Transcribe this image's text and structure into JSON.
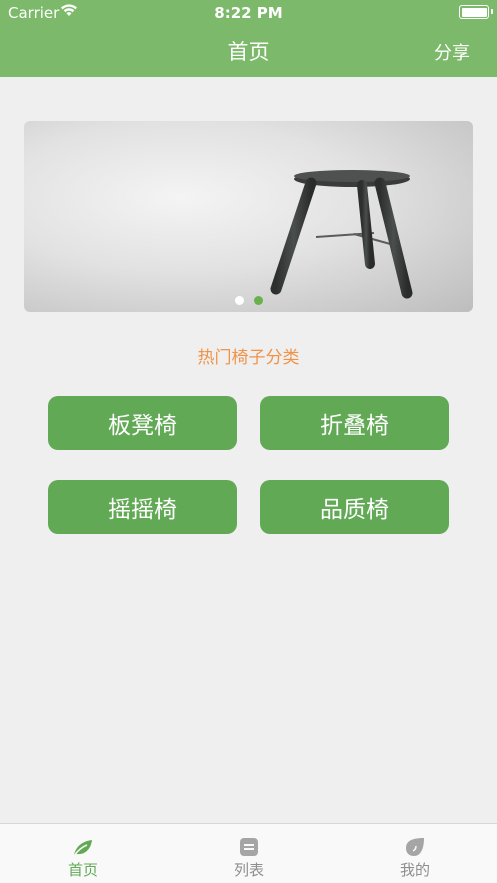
{
  "status_bar": {
    "carrier": "Carrier",
    "time": "8:22 PM"
  },
  "nav": {
    "title": "首页",
    "share_label": "分享"
  },
  "banner": {
    "page_count": 2,
    "active_page": 2
  },
  "section_title": "热门椅子分类",
  "categories": [
    {
      "label": "板凳椅"
    },
    {
      "label": "折叠椅"
    },
    {
      "label": "摇摇椅"
    },
    {
      "label": "品质椅"
    }
  ],
  "tabbar": {
    "items": [
      {
        "label": "首页",
        "icon": "leaf-icon",
        "active": true
      },
      {
        "label": "列表",
        "icon": "list-icon",
        "active": false
      },
      {
        "label": "我的",
        "icon": "profile-leaf-icon",
        "active": false
      }
    ]
  },
  "colors": {
    "nav_green": "#7cb96a",
    "button_green": "#62a956",
    "section_orange": "#f09348",
    "active_dot": "#6ab04c"
  }
}
